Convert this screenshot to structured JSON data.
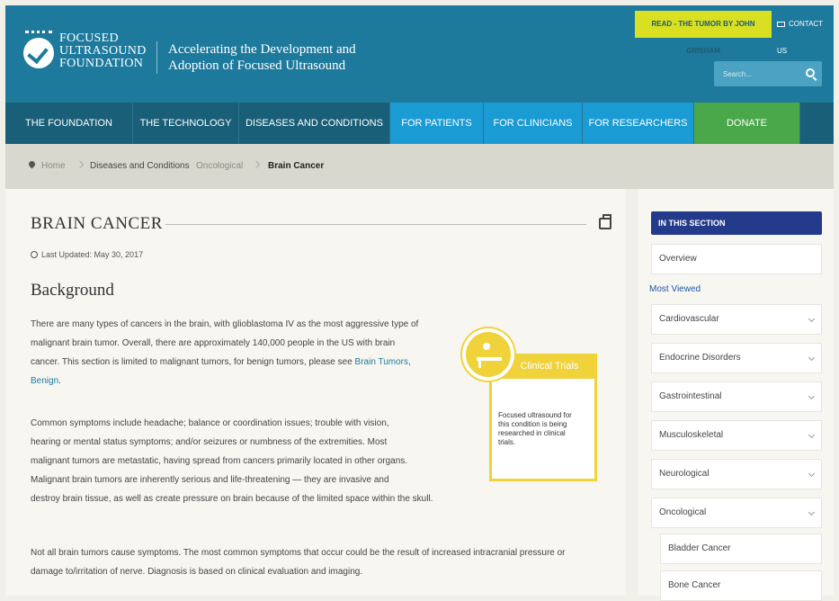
{
  "header": {
    "logo": [
      "FOCUSED",
      "ULTRASOUND",
      "FOUNDATION"
    ],
    "tagline": [
      "Accelerating the Development and",
      "Adoption of Focused Ultrasound"
    ],
    "read_link": "READ - THE TUMOR BY JOHN GRISHAM",
    "contact": "CONTACT US",
    "search_placeholder": "Search...",
    "colors": {
      "header_bg": "#1e7a9c",
      "read_bg": "#d9e021",
      "search_bg": "#4ba2c2"
    }
  },
  "nav": [
    {
      "label": "THE FOUNDATION",
      "style": "dark"
    },
    {
      "label": "THE TECHNOLOGY",
      "style": "dark"
    },
    {
      "label": "DISEASES AND CONDITIONS",
      "style": "dark"
    },
    {
      "label": "FOR PATIENTS",
      "style": "blue"
    },
    {
      "label": "FOR CLINICIANS",
      "style": "blue"
    },
    {
      "label": "FOR RESEARCHERS",
      "style": "blue"
    },
    {
      "label": "DONATE",
      "style": "green"
    }
  ],
  "breadcrumb": {
    "home": "Home",
    "diseases": "Diseases and Conditions",
    "category": "Oncological",
    "current": "Brain Cancer"
  },
  "article": {
    "title": "BRAIN CANCER",
    "updated": "Last Updated: May 30, 2017",
    "heading": "Background",
    "p1_lines": [
      "There are many types of cancers in the brain, with glioblastoma IV as the most aggressive type of",
      "malignant brain tumor. Overall, there are approximately 140,000 people in the US with brain",
      "cancer. This section is limited to malignant tumors, for benign tumors, please see"
    ],
    "p1_link_a": "Brain Tumors,",
    "p1_link_b": "Benign",
    "p2_lines": [
      "Common symptoms include headache; balance or coordination issues; trouble with vision,",
      "hearing or mental status symptoms; and/or seizures or numbness of the extremities. Most",
      "malignant tumors are metastatic, having spread from cancers primarily located in other organs.",
      "Malignant brain tumors are inherently serious and life-threatening — they are invasive and",
      "destroy brain tissue, as well as create pressure on brain because of the limited space within the skull."
    ],
    "p3_lines": [
      "Not all brain tumors cause symptoms. The most common symptoms that occur could be the result of increased intracranial pressure or",
      "damage to/irritation of nerve. Diagnosis is based on clinical evaluation and imaging."
    ]
  },
  "clinical_trials": {
    "title": "Clinical Trials",
    "text": "Focused ultrasound for this condition is being researched in clinical trials.",
    "color": "#f0d23a"
  },
  "sidebar": {
    "heading": "IN THIS SECTION",
    "overview": "Overview",
    "most_viewed": "Most Viewed",
    "items": [
      "Cardiovascular",
      "Endocrine Disorders",
      "Gastrointestinal",
      "Musculoskeletal",
      "Neurological",
      "Oncological"
    ],
    "sub_items": [
      "Bladder Cancer",
      "Bone Cancer"
    ],
    "heading_color": "#243a8a"
  }
}
